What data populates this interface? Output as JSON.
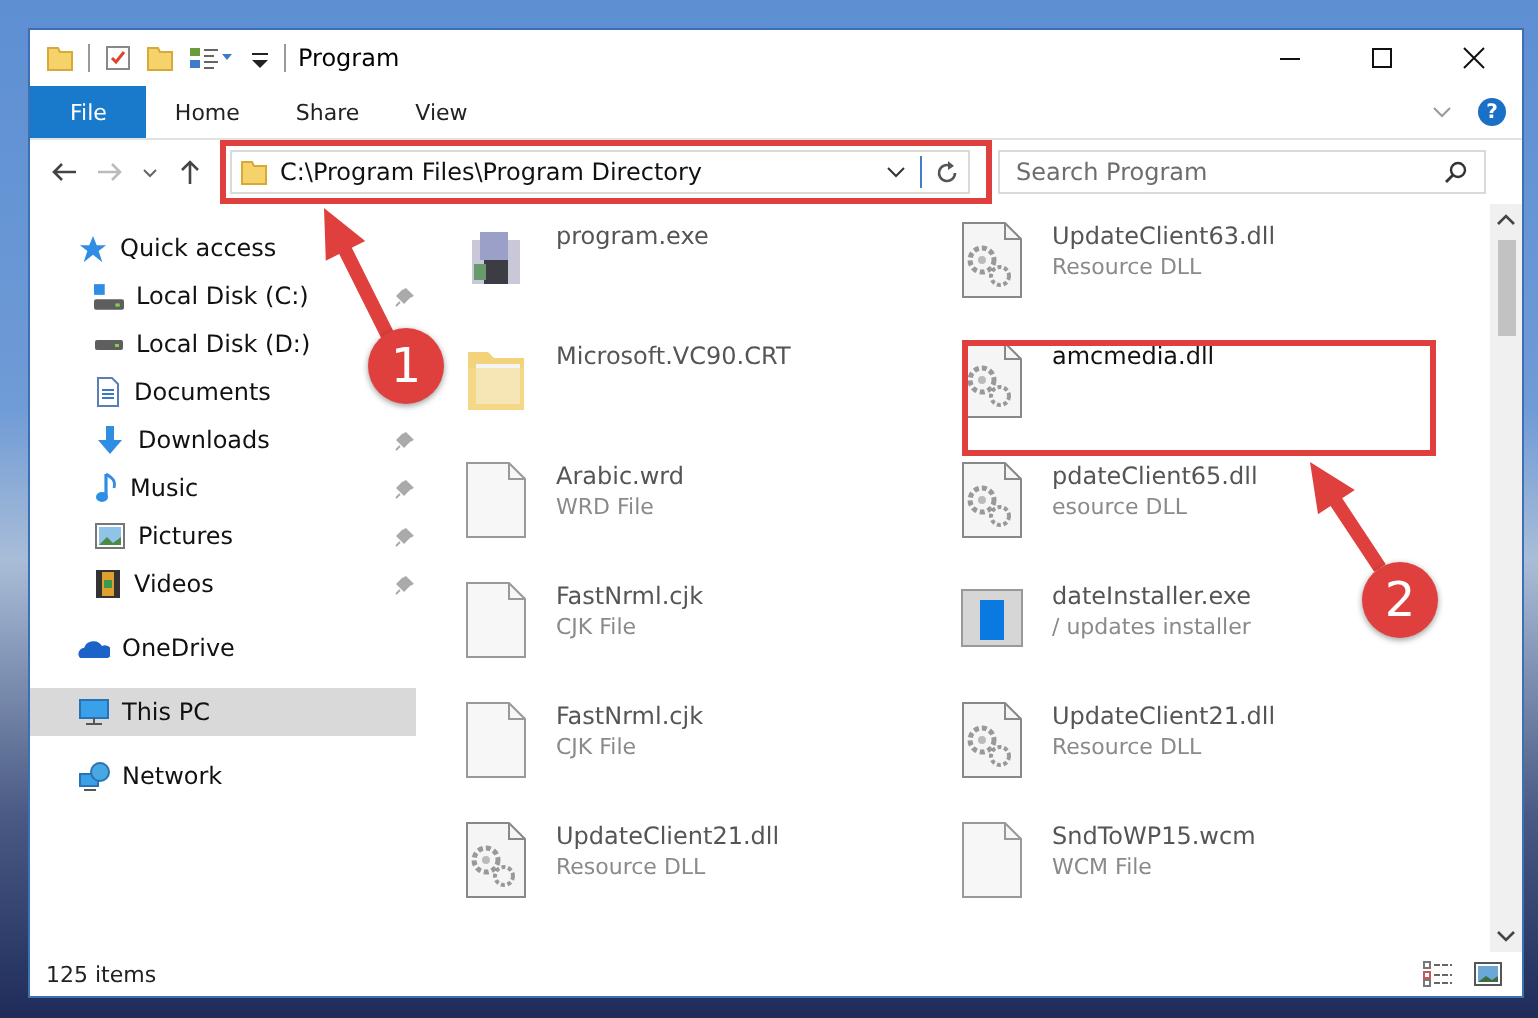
{
  "window": {
    "title": "Program"
  },
  "ribbon_tabs": [
    {
      "label": "File",
      "selected": true
    },
    {
      "label": "Home",
      "selected": false
    },
    {
      "label": "Share",
      "selected": false
    },
    {
      "label": "View",
      "selected": false
    }
  ],
  "help": "?",
  "address": {
    "path": "C:\\Program Files\\Program Directory"
  },
  "search": {
    "placeholder": "Search Program"
  },
  "navigation": [
    {
      "label": "Quick access",
      "kind": "quick",
      "selected": false,
      "children": [
        {
          "label": "Local Disk (C:)",
          "kind": "disk-c",
          "pinned": true,
          "selected": false
        },
        {
          "label": "Local Disk (D:)",
          "kind": "disk",
          "pinned": false,
          "selected": false
        },
        {
          "label": "Documents",
          "kind": "documents",
          "pinned": false,
          "selected": false
        },
        {
          "label": "Downloads",
          "kind": "downloads",
          "pinned": true,
          "selected": false
        },
        {
          "label": "Music",
          "kind": "music",
          "pinned": true,
          "selected": false
        },
        {
          "label": "Pictures",
          "kind": "pictures",
          "pinned": true,
          "selected": false
        },
        {
          "label": "Videos",
          "kind": "videos",
          "pinned": true,
          "selected": false
        }
      ]
    },
    {
      "label": "OneDrive",
      "kind": "cloud",
      "selected": false
    },
    {
      "label": "This PC",
      "kind": "pc",
      "selected": true
    },
    {
      "label": "Network",
      "kind": "network",
      "selected": false
    }
  ],
  "files": [
    {
      "name": "program.exe",
      "kind": "app",
      "blurred": true
    },
    {
      "name": "UpdateClient63.dll",
      "type": "Resource DLL",
      "kind": "dll",
      "blurred": true
    },
    {
      "name": "Microsoft.VC90.CRT",
      "kind": "folder",
      "blurred": true
    },
    {
      "name": "amcmedia.dll",
      "kind": "dll",
      "blurred": false
    },
    {
      "name": "Arabic.wrd",
      "type": "WRD File",
      "kind": "blank",
      "blurred": true
    },
    {
      "name": "pdateClient65.dll",
      "type": "esource DLL",
      "kind": "dll",
      "blurred": true
    },
    {
      "name": "FastNrml.cjk",
      "type": "CJK File",
      "kind": "blank",
      "blurred": true
    },
    {
      "name": "dateInstaller.exe",
      "type": "/ updates installer",
      "kind": "installer",
      "blurred": true
    },
    {
      "name": "FastNrml.cjk",
      "type": "CJK File",
      "kind": "blank",
      "blurred": true
    },
    {
      "name": "UpdateClient21.dll",
      "type": "Resource DLL",
      "kind": "dll",
      "blurred": true
    },
    {
      "name": "UpdateClient21.dll",
      "type": "Resource DLL",
      "kind": "dll",
      "blurred": true
    },
    {
      "name": "SndToWP15.wcm",
      "type": "WCM File",
      "kind": "blank",
      "blurred": true
    }
  ],
  "status_bar": {
    "count": "125 items"
  },
  "annotations": [
    {
      "label": "1"
    },
    {
      "label": "2"
    }
  ]
}
